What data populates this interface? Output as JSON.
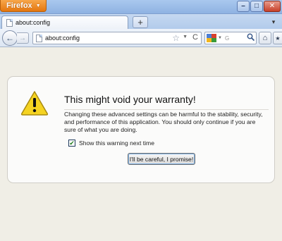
{
  "window": {
    "app_button_label": "Firefox",
    "controls": {
      "minimize": "–",
      "maximize": "□",
      "close": "✕"
    }
  },
  "tabs": [
    {
      "title": "about:config",
      "active": true
    }
  ],
  "tabstrip": {
    "new_tab_label": "+",
    "tab_list_label": "▾"
  },
  "navbar": {
    "back_label": "←",
    "forward_label": "→",
    "url": "about:config",
    "bookmark_star": "☆",
    "reload_label": "C",
    "search_placeholder": "G",
    "search_engine_icon": "google-icon",
    "home_label": "⌂",
    "bookmarks_menu_label": "★"
  },
  "warning": {
    "title": "This might void your warranty!",
    "message": "Changing these advanced settings can be harmful to the stability, security, and performance of this application. You should only continue if you are sure of what you are doing.",
    "checkbox_label": "Show this warning next time",
    "checkbox_checked": true,
    "checkbox_mark": "✔",
    "confirm_button_label": "I'll be careful, I promise!"
  },
  "colors": {
    "app_button": "#e4760f",
    "page_background": "#f0eee6",
    "warning_yellow": "#f5d321"
  }
}
